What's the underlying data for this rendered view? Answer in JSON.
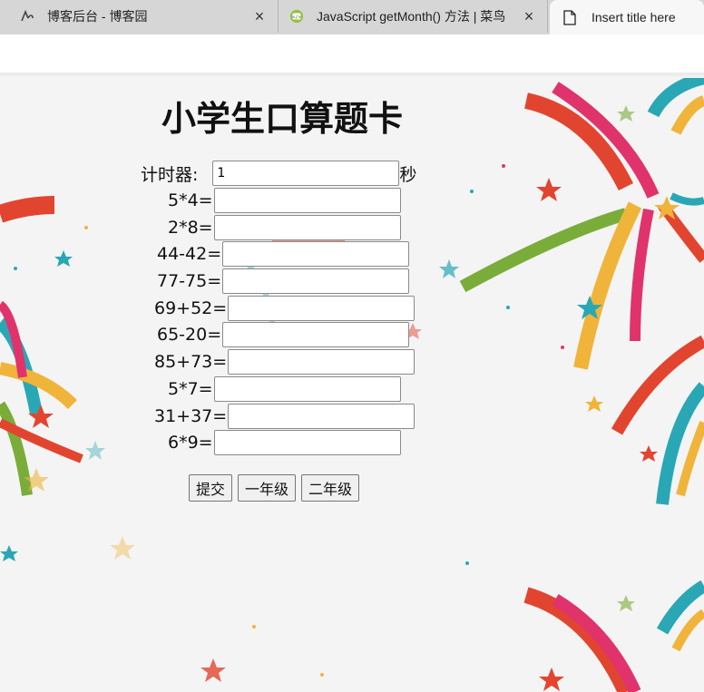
{
  "tabs": [
    {
      "title": "博客后台 - 博客园",
      "close": "×",
      "icon": "cnblogs-icon"
    },
    {
      "title": "JavaScript getMonth() 方法 | 菜鸟",
      "close": "×",
      "icon": "runoob-icon"
    },
    {
      "title": "Insert title here",
      "icon": "document-icon"
    }
  ],
  "page": {
    "title": "小学生口算题卡",
    "timer": {
      "label": "计时器:",
      "value": "1",
      "unit": "秒"
    },
    "problems": [
      {
        "expr": "5*4="
      },
      {
        "expr": "2*8="
      },
      {
        "expr": "44-42="
      },
      {
        "expr": "77-75="
      },
      {
        "expr": "69+52="
      },
      {
        "expr": "65-20="
      },
      {
        "expr": "85+73="
      },
      {
        "expr": "5*7="
      },
      {
        "expr": "31+37="
      },
      {
        "expr": "6*9="
      }
    ],
    "buttons": {
      "submit": "提交",
      "grade1": "一年级",
      "grade2": "二年级"
    }
  },
  "colors": {
    "tabstrip_bg": "#d6d6d6",
    "page_bg": "#f4f4f4",
    "firework_red": "#e2452f",
    "firework_teal": "#2aa7b5",
    "firework_yellow": "#f0b43a",
    "firework_green": "#7aac3a",
    "firework_pink": "#e0336c"
  }
}
